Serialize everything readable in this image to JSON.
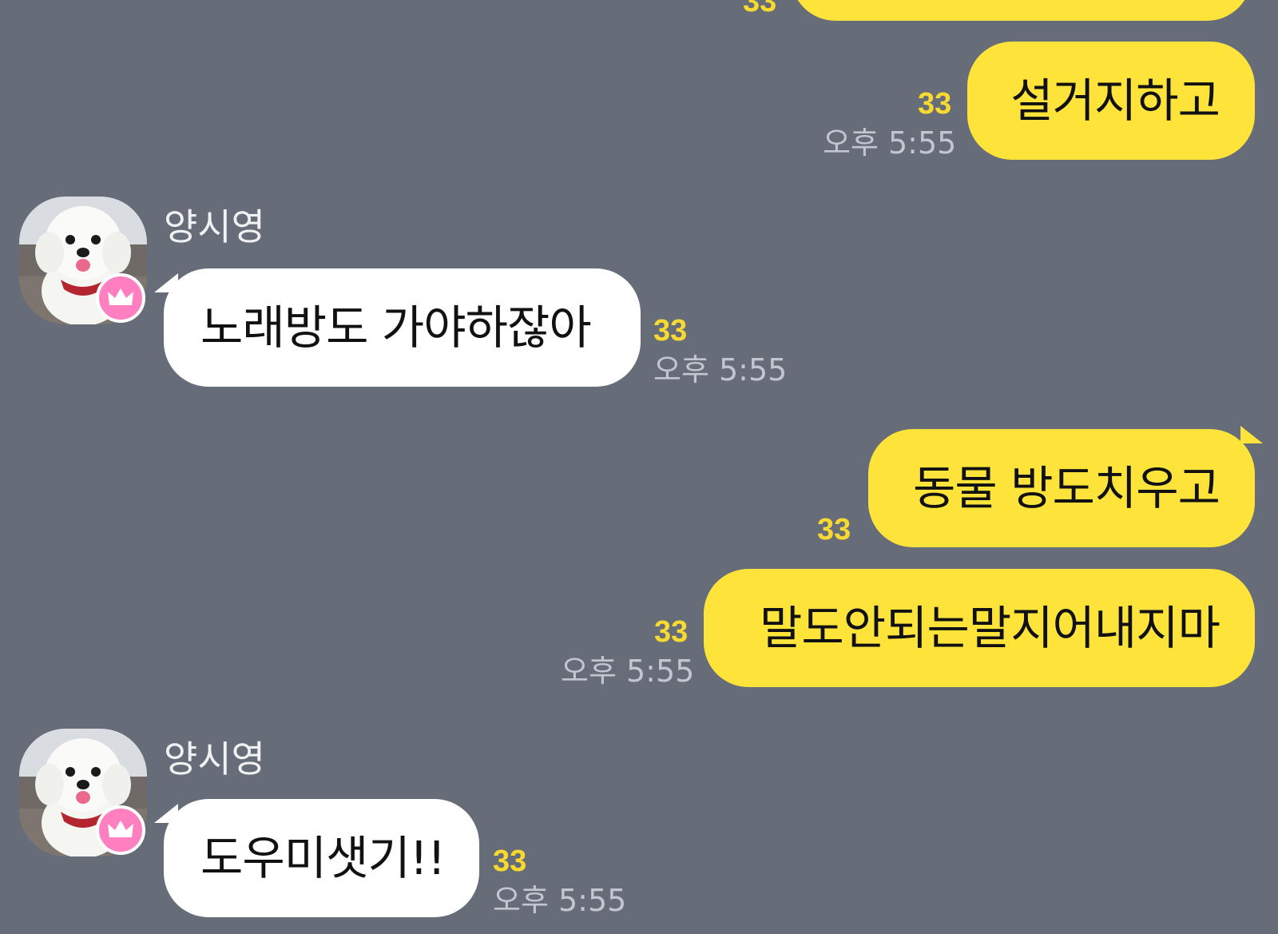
{
  "messages": [
    {
      "side": "mine",
      "text": "",
      "count": "33",
      "time": ""
    },
    {
      "side": "mine",
      "text": "설거지하고",
      "count": "33",
      "time": "오후 5:55"
    },
    {
      "side": "theirs",
      "sender": "양시영",
      "text": "노래방도 가야하잖아",
      "count": "33",
      "time": "오후 5:55",
      "avatar_icon": "white-dog-photo",
      "badge_icon": "crown-icon"
    },
    {
      "side": "mine",
      "text": "동물 방도치우고",
      "count": "33",
      "time": ""
    },
    {
      "side": "mine",
      "text": "말도안되는말지어내지마",
      "count": "33",
      "time": "오후 5:55"
    },
    {
      "side": "theirs",
      "sender": "양시영",
      "text": "도우미샛기!!",
      "count": "33",
      "time": "오후 5:55",
      "avatar_icon": "white-dog-photo",
      "badge_icon": "crown-icon"
    }
  ],
  "colors": {
    "background": "#666d78",
    "my_bubble": "#fee33a",
    "their_bubble": "#ffffff",
    "unread_count": "#f7d931",
    "timestamp": "#c2c7cf",
    "badge": "#ff7fc0"
  }
}
